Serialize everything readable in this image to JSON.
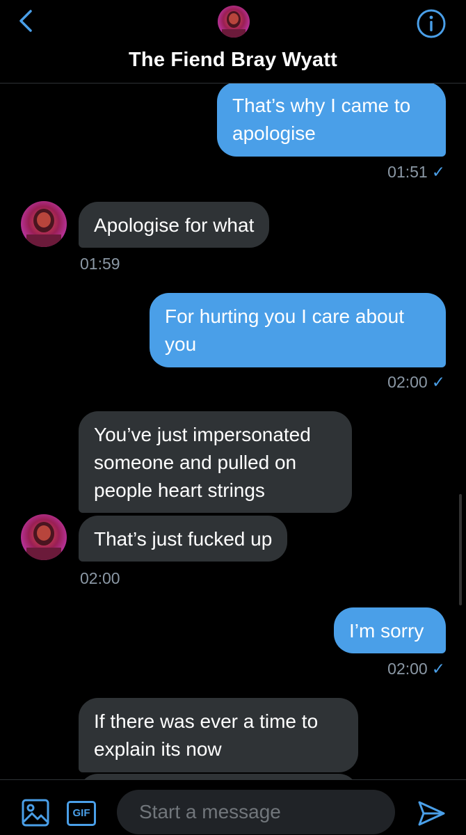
{
  "header": {
    "title": "The Fiend Bray Wyatt",
    "back_icon": "chevron-left-icon",
    "info_icon": "info-icon"
  },
  "messages": [
    {
      "direction": "out",
      "text": "That’s why I came to apologise",
      "time": "01:51"
    },
    {
      "direction": "in",
      "text": "Apologise for what",
      "time": "01:59"
    },
    {
      "direction": "out",
      "text": "For hurting you I care about you",
      "time": "02:00"
    },
    {
      "direction": "in",
      "text": "You’ve just impersonated someone and pulled on people heart strings"
    },
    {
      "direction": "in",
      "text": "That’s just fucked up",
      "time": "02:00"
    },
    {
      "direction": "out",
      "text": "I’m sorry",
      "time": "02:00"
    },
    {
      "direction": "in",
      "text": "If there was ever a time to explain its now"
    }
  ],
  "read_mark": "✓",
  "composer": {
    "image_icon": "image-icon",
    "gif_label": "GIF",
    "placeholder": "Start a message",
    "send_icon": "send-icon"
  },
  "colors": {
    "accent": "#4a9fe8",
    "incoming_bubble": "#2f3336",
    "background": "#000000",
    "timestamp": "#8b98a5"
  }
}
